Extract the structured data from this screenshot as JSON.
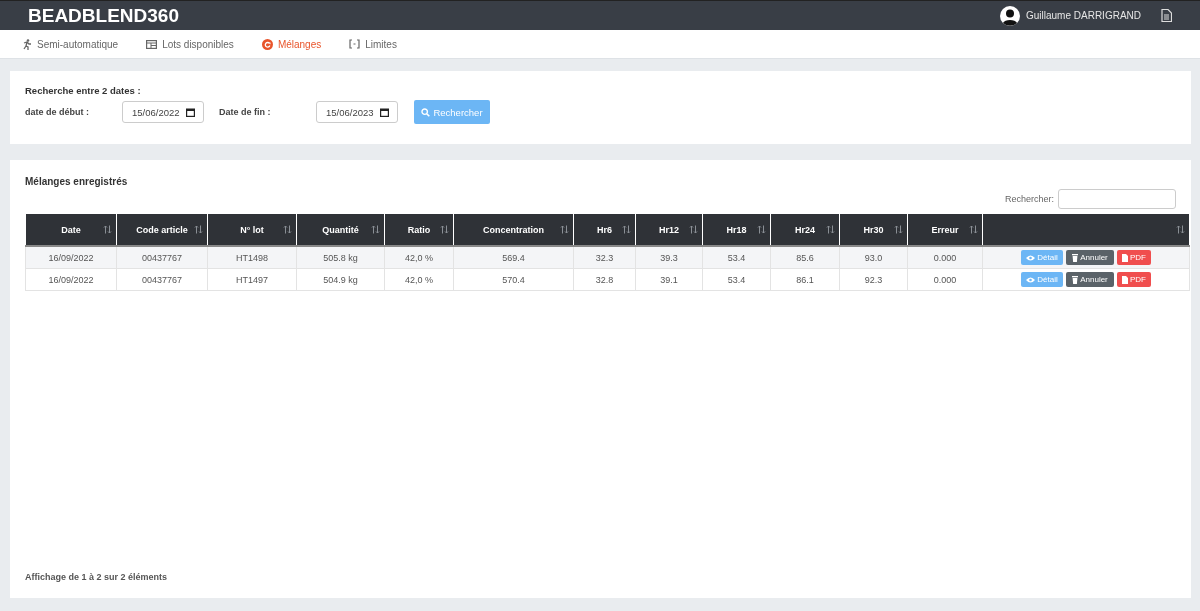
{
  "app": {
    "title": "BEADBLEND360",
    "user": "Guillaume DARRIGRAND"
  },
  "nav": [
    {
      "label": "Semi-automatique",
      "selected": false
    },
    {
      "label": "Lots disponibles",
      "selected": false
    },
    {
      "label": "Mélanges",
      "selected": true
    },
    {
      "label": "Limites",
      "selected": false
    }
  ],
  "search_panel": {
    "title": "Recherche entre 2 dates :",
    "start_label": "date de début :",
    "start_value": "15/06/2022",
    "end_label": "Date de fin :",
    "end_value": "15/06/2023",
    "button": "Rechercher"
  },
  "table_panel": {
    "title": "Mélanges enregistrés",
    "filter_label": "Rechercher:",
    "columns": [
      "Date",
      "Code article",
      "N° lot",
      "Quantité",
      "Ratio",
      "Concentration",
      "Hr6",
      "Hr12",
      "Hr18",
      "Hr24",
      "Hr30",
      "Erreur",
      ""
    ],
    "rows": [
      {
        "cells": [
          "16/09/2022",
          "00437767",
          "HT1498",
          "505.8 kg",
          "42,0 %",
          "569.4",
          "32.3",
          "39.3",
          "53.4",
          "85.6",
          "93.0",
          "0.000"
        ],
        "actions": [
          "Détail",
          "Annuler",
          "PDF"
        ]
      },
      {
        "cells": [
          "16/09/2022",
          "00437767",
          "HT1497",
          "504.9 kg",
          "42,0 %",
          "570.4",
          "32.8",
          "39.1",
          "53.4",
          "86.1",
          "92.3",
          "0.000"
        ],
        "actions": [
          "Détail",
          "Annuler",
          "PDF"
        ]
      }
    ],
    "info": "Affichage de 1 à 2 sur 2 éléments"
  }
}
